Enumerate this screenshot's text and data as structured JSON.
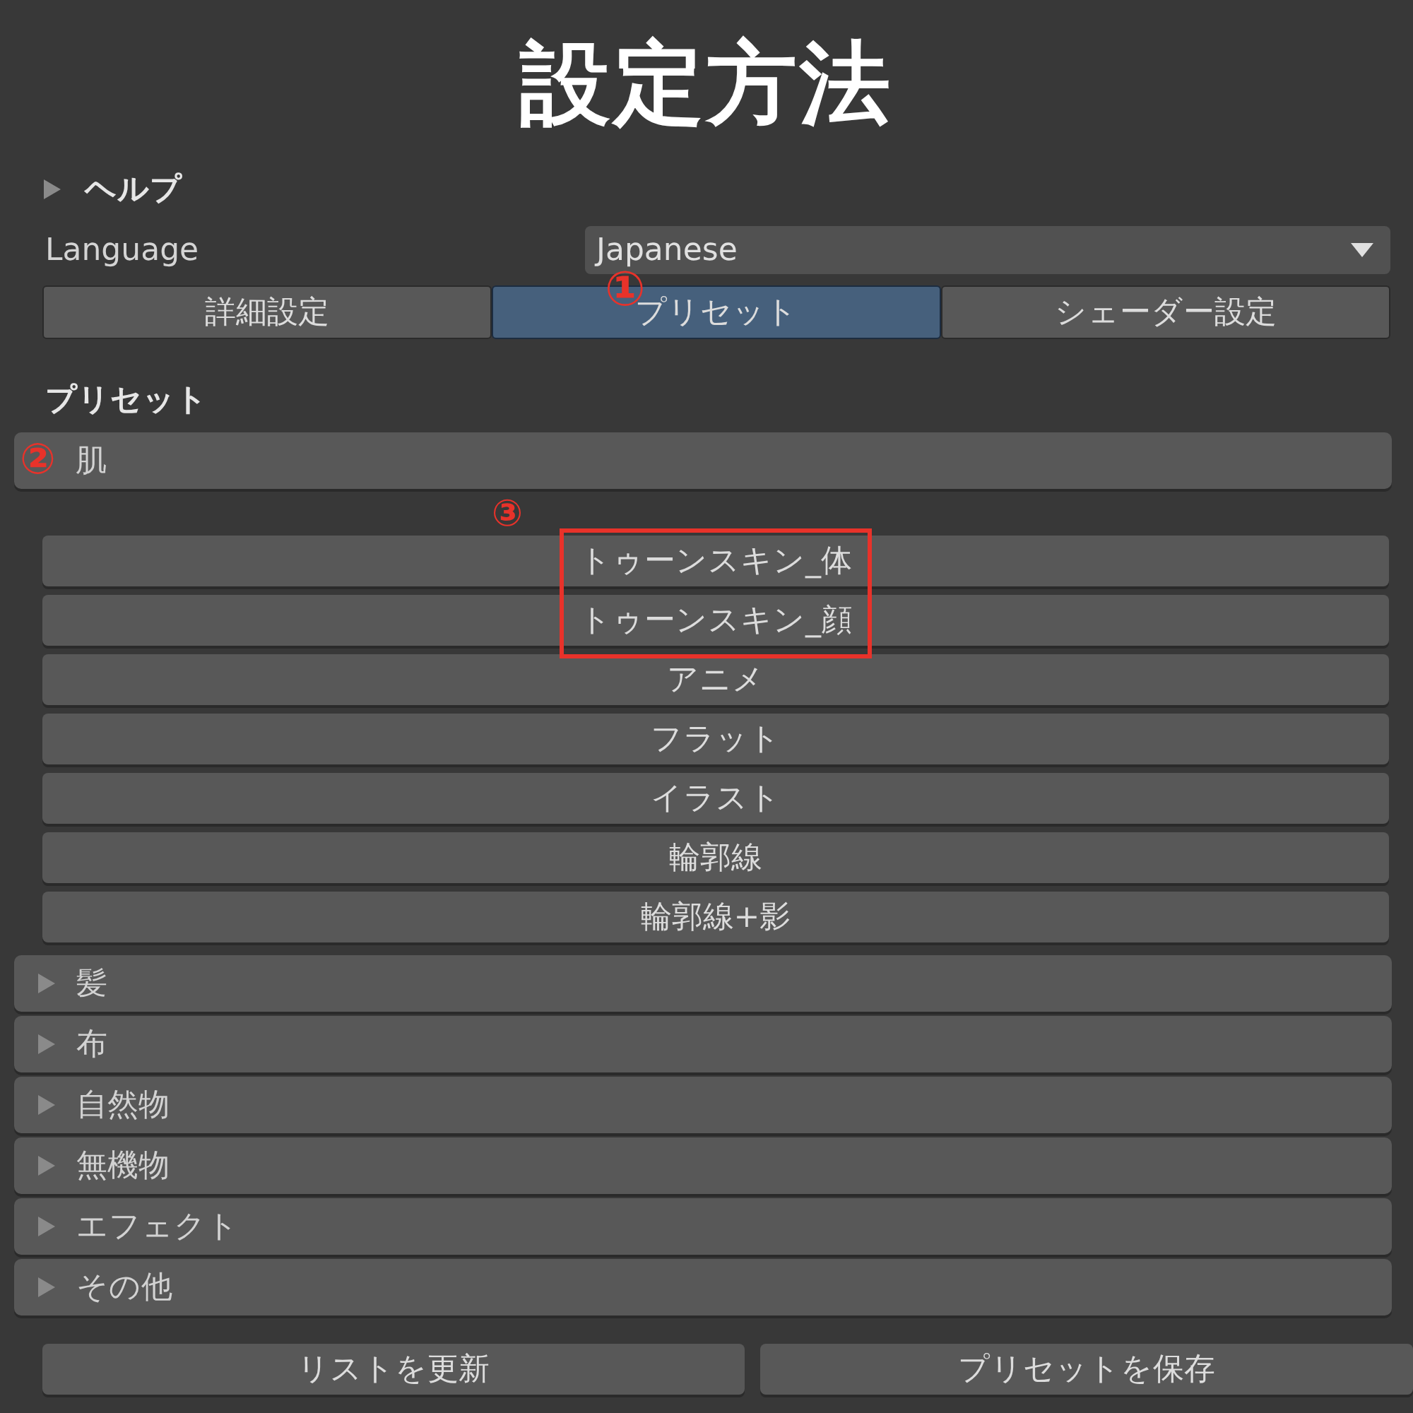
{
  "title": "設定方法",
  "help": {
    "label": "ヘルプ",
    "expanded": false
  },
  "language": {
    "label": "Language",
    "value": "Japanese"
  },
  "tabs": [
    {
      "label": "詳細設定",
      "selected": false
    },
    {
      "label": "プリセット",
      "selected": true,
      "marker": "①"
    },
    {
      "label": "シェーダー設定",
      "selected": false
    }
  ],
  "preset_heading": "プリセット",
  "categories": [
    {
      "label": "肌",
      "expanded": true,
      "marker": "②",
      "highlight_marker": "③",
      "presets": [
        {
          "label": "トゥーンスキン_体",
          "highlighted": true
        },
        {
          "label": "トゥーンスキン_顔",
          "highlighted": true
        },
        {
          "label": "アニメ",
          "highlighted": false
        },
        {
          "label": "フラット",
          "highlighted": false
        },
        {
          "label": "イラスト",
          "highlighted": false
        },
        {
          "label": "輪郭線",
          "highlighted": false
        },
        {
          "label": "輪郭線+影",
          "highlighted": false
        }
      ]
    },
    {
      "label": "髪",
      "expanded": false
    },
    {
      "label": "布",
      "expanded": false
    },
    {
      "label": "自然物",
      "expanded": false
    },
    {
      "label": "無機物",
      "expanded": false
    },
    {
      "label": "エフェクト",
      "expanded": false
    },
    {
      "label": "その他",
      "expanded": false
    }
  ],
  "buttons": [
    "リストを更新",
    "プリセットを保存"
  ]
}
